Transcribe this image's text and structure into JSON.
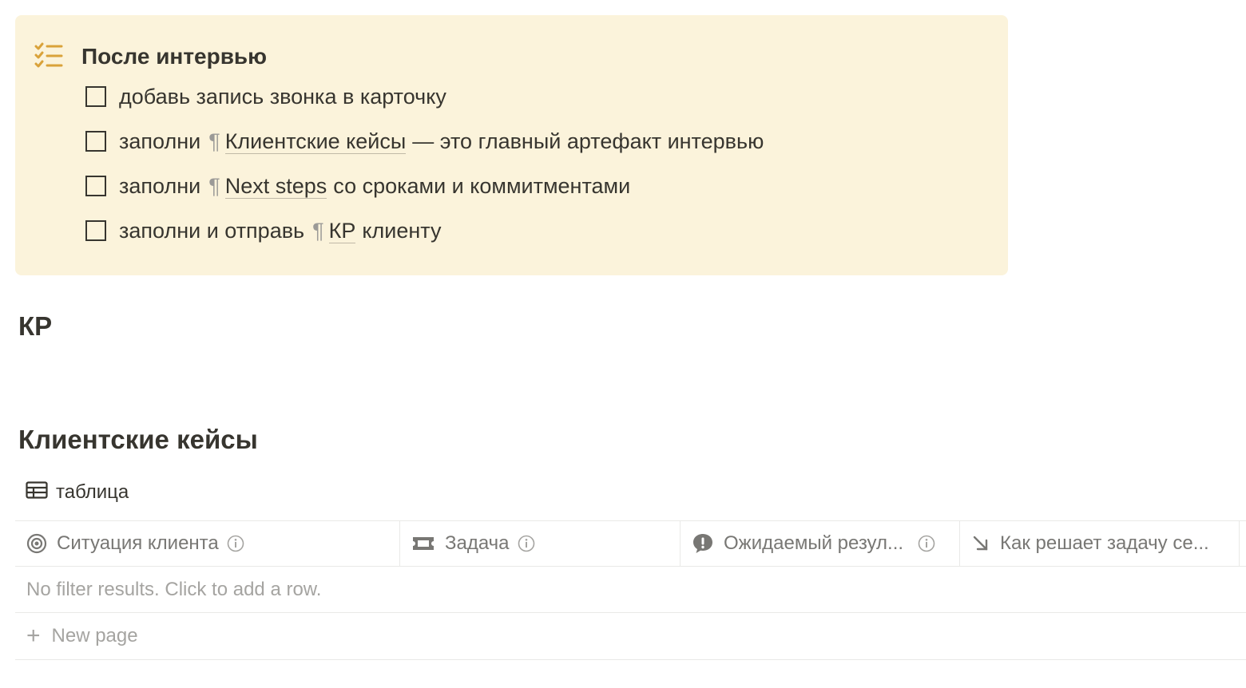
{
  "callout": {
    "icon": "checklist-icon",
    "accent_color": "#d9a23a",
    "background": "#fbf3db",
    "title": "После интервью",
    "todos": [
      {
        "checked": false,
        "parts": [
          {
            "text": "добавь запись звонка в карточку"
          }
        ]
      },
      {
        "checked": false,
        "before": "заполни",
        "link": "Клиентские кейсы",
        "after": "— это главный артефакт интервью"
      },
      {
        "checked": false,
        "before": "заполни",
        "link": "Next steps",
        "after": "со сроками и коммитментами"
      },
      {
        "checked": false,
        "before": "заполни и отправь",
        "link": "КР",
        "after": "клиенту"
      }
    ]
  },
  "sections": {
    "kp_heading": "КР",
    "cases_heading": "Клиентские кейсы"
  },
  "database": {
    "view_icon": "table-icon",
    "view_name": "таблица",
    "columns": [
      {
        "icon": "target-icon",
        "label": "Ситуация клиента"
      },
      {
        "icon": "ticket-icon",
        "label": "Задача"
      },
      {
        "icon": "alert-bubble-icon",
        "label": "Ожидаемый резул..."
      },
      {
        "icon": "arrow-down-right-icon",
        "label": "Как решает задачу се..."
      }
    ],
    "empty_text": "No filter results. Click to add a row.",
    "new_page_label": "New page"
  }
}
